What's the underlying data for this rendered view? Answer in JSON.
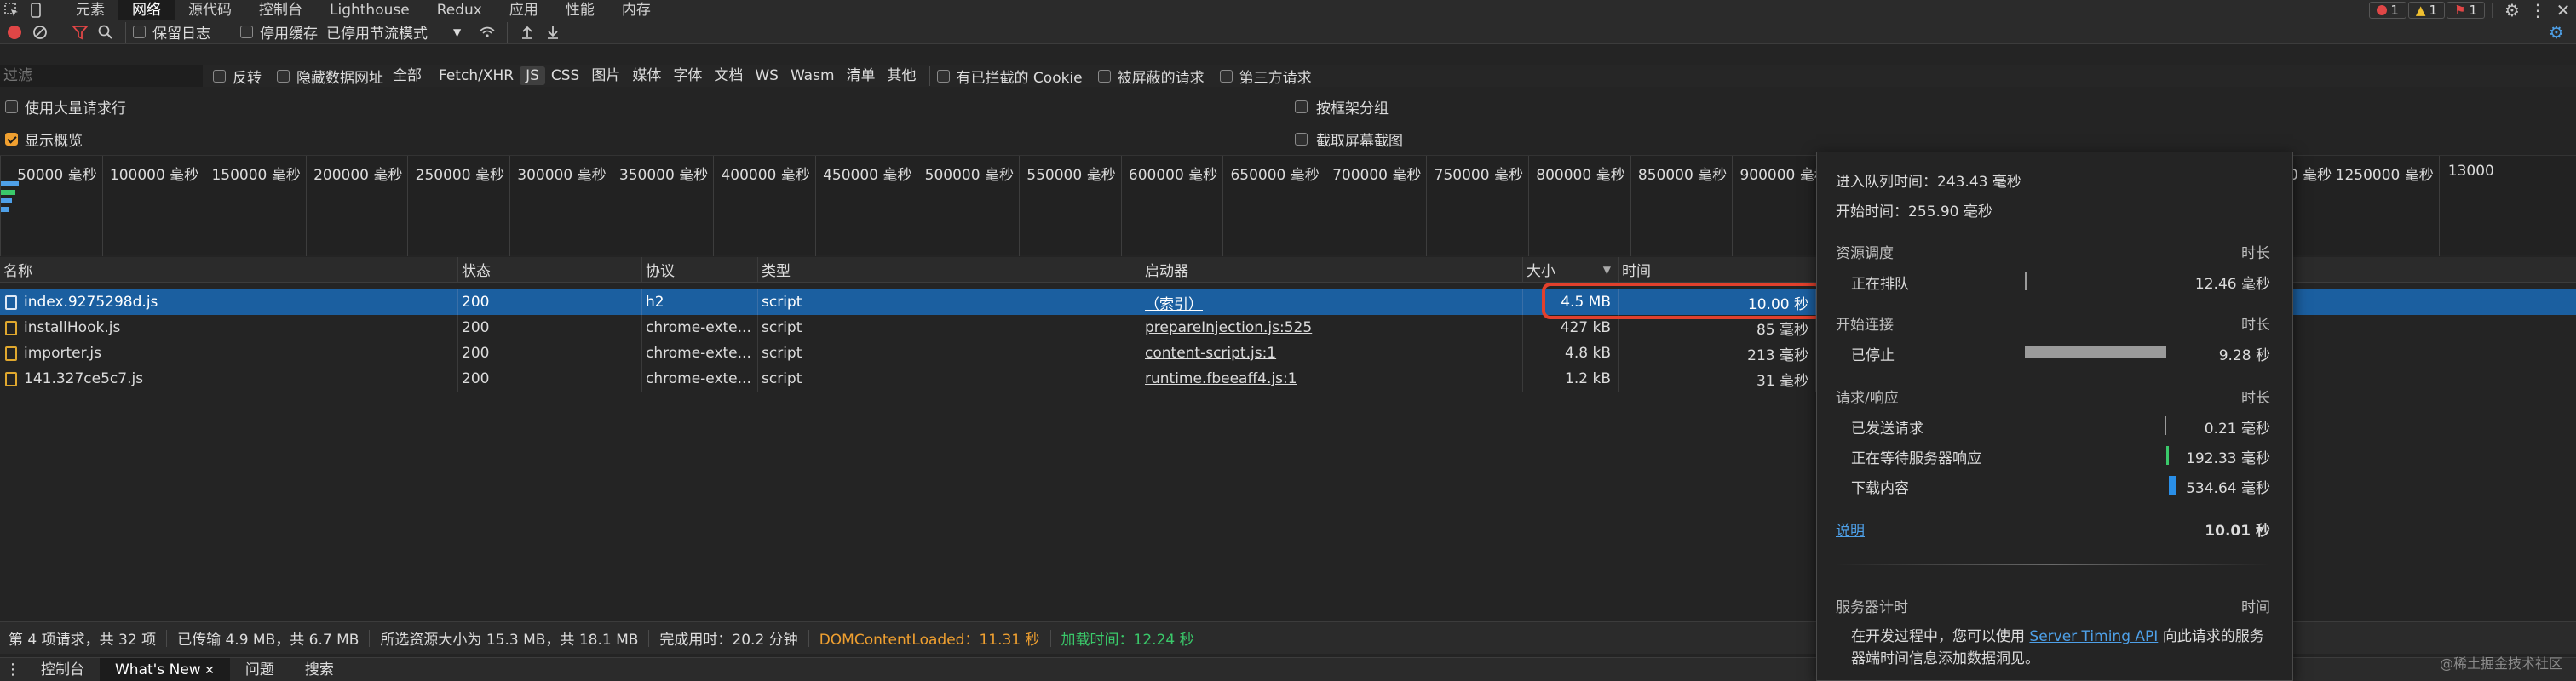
{
  "topbar": {
    "tabs": [
      "元素",
      "网络",
      "源代码",
      "控制台",
      "Lighthouse",
      "Redux",
      "应用",
      "性能",
      "内存"
    ],
    "active_tab": "网络",
    "errors": "1",
    "warnings": "1",
    "issues": "1"
  },
  "toolbar": {
    "preserve_log": "保留日志",
    "disable_cache": "停用缓存",
    "throttling": "已停用节流模式"
  },
  "filter": {
    "placeholder": "过滤",
    "invert": "反转",
    "hide_data_urls": "隐藏数据网址",
    "types": [
      "全部",
      "Fetch/XHR",
      "JS",
      "CSS",
      "图片",
      "媒体",
      "字体",
      "文档",
      "WS",
      "Wasm",
      "清单",
      "其他"
    ],
    "active_type": "JS",
    "blocked_cookies": "有已拦截的 Cookie",
    "blocked_requests": "被屏蔽的请求",
    "third_party": "第三方请求"
  },
  "options": {
    "large_rows": "使用大量请求行",
    "group_by_frame": "按框架分组",
    "show_overview": "显示概览",
    "screenshots": "截取屏幕截图"
  },
  "overview": {
    "ticks": [
      "50000 毫秒",
      "100000 毫秒",
      "150000 毫秒",
      "200000 毫秒",
      "250000 毫秒",
      "300000 毫秒",
      "350000 毫秒",
      "400000 毫秒",
      "450000 毫秒",
      "500000 毫秒",
      "550000 毫秒",
      "600000 毫秒",
      "650000 毫秒",
      "700000 毫秒",
      "750000 毫秒",
      "800000 毫秒",
      "850000 毫秒",
      "900000 毫秒",
      "1200000 毫秒",
      "1250000 毫秒",
      "13000"
    ]
  },
  "table": {
    "headers": {
      "name": "名称",
      "status": "状态",
      "protocol": "协议",
      "type": "类型",
      "initiator": "启动器",
      "size": "大小",
      "time": "时间"
    },
    "rows": [
      {
        "name": "index.9275298d.js",
        "status": "200",
        "protocol": "h2",
        "type": "script",
        "initiator": "（索引）",
        "size": "4.5 MB",
        "time": "10.00 秒"
      },
      {
        "name": "installHook.js",
        "status": "200",
        "protocol": "chrome-exte...",
        "type": "script",
        "initiator": "prepareInjection.js:525",
        "size": "427 kB",
        "time": "85 毫秒"
      },
      {
        "name": "importer.js",
        "status": "200",
        "protocol": "chrome-exte...",
        "type": "script",
        "initiator": "content-script.js:1",
        "size": "4.8 kB",
        "time": "213 毫秒"
      },
      {
        "name": "141.327ce5c7.js",
        "status": "200",
        "protocol": "chrome-exte...",
        "type": "script",
        "initiator": "runtime.fbeeaff4.js:1",
        "size": "1.2 kB",
        "time": "31 毫秒"
      }
    ]
  },
  "status": {
    "requests": "第 4 项请求，共 32 项",
    "transferred": "已传输 4.9 MB，共 6.7 MB",
    "resources": "所选资源大小为 15.3 MB，共 18.1 MB",
    "finish": "完成用时：20.2 分钟",
    "dcl": "DOMContentLoaded：11.31 秒",
    "load": "加载时间：12.24 秒",
    "dcl_color": "#f0a030",
    "load_color": "#3ac96a"
  },
  "drawer": {
    "tabs": [
      "控制台",
      "What's New",
      "问题",
      "搜索"
    ],
    "active_tab": "What's New"
  },
  "timing": {
    "queued_at": "进入队列时间：243.43 毫秒",
    "started_at": "开始时间：255.90 毫秒",
    "resource_scheduling": "资源调度",
    "duration_label": "时长",
    "queueing": "正在排队",
    "queueing_time": "12.46 毫秒",
    "connection_start": "开始连接",
    "stalled": "已停止",
    "stalled_time": "9.28 秒",
    "request_response": "请求/响应",
    "request_sent": "已发送请求",
    "request_sent_time": "0.21 毫秒",
    "waiting": "正在等待服务器响应",
    "waiting_time": "192.33 毫秒",
    "download": "下载内容",
    "download_time": "534.64 毫秒",
    "explanation": "说明",
    "total": "10.01 秒",
    "server_timing": "服务器计时",
    "time_label": "时间",
    "server_note_1": "在开发过程中，您可以使用",
    "server_link": "Server Timing API",
    "server_note_2": "向此请求的服务器端时间信息添加数据洞见。"
  },
  "watermark": "@稀土掘金技术社区"
}
